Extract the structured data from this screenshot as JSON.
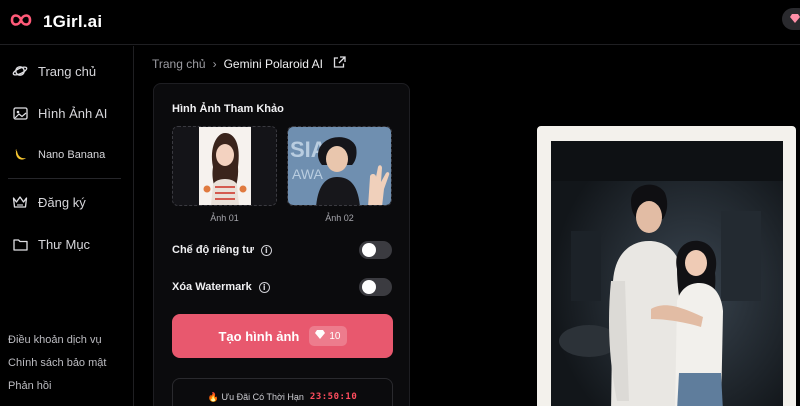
{
  "app": {
    "brand": "1Girl.ai"
  },
  "sidebar": {
    "items": [
      {
        "label": "Trang chủ",
        "icon": "planet-icon"
      },
      {
        "label": "Hình Ảnh AI",
        "icon": "image-icon"
      },
      {
        "label": "Nano Banana",
        "icon": "banana-icon"
      },
      {
        "label": "Đăng ký",
        "icon": "crown-icon"
      },
      {
        "label": "Thư Mục",
        "icon": "folder-icon"
      }
    ],
    "footer": [
      "Điều khoản dịch vụ",
      "Chính sách bảo mật",
      "Phản hồi"
    ]
  },
  "breadcrumb": {
    "home": "Trang chủ",
    "current": "Gemini Polaroid AI"
  },
  "panel": {
    "reference_title": "Hình Ảnh Tham Khảo",
    "images": [
      {
        "caption": "Ảnh 01"
      },
      {
        "caption": "Ảnh 02"
      }
    ],
    "privacy_label": "Chế độ riêng tư",
    "privacy_on": false,
    "watermark_label": "Xóa Watermark",
    "watermark_on": false,
    "generate_label": "Tạo hình ảnh",
    "generate_cost": "10",
    "promo_text": "🔥 Ưu Đãi Có Thời Hạn",
    "promo_timer": "23:50:10"
  },
  "colors": {
    "accent": "#e8586e",
    "brand": "#ff5a78",
    "timer": "#ff4d5e"
  }
}
